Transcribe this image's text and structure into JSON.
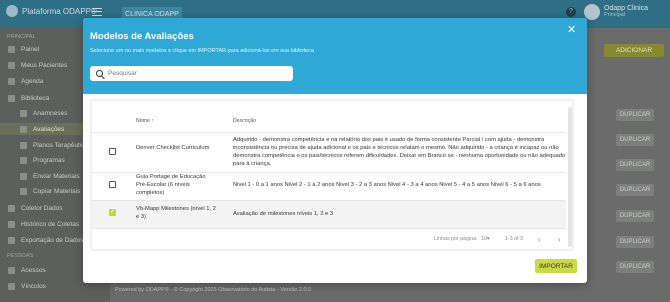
{
  "app": {
    "brand": "Plataforma ODAPP®",
    "clinic_button": "CLINICA ODAPP",
    "user_name": "Odapp Clinica",
    "user_role": "Principal"
  },
  "sidebar": {
    "section_main": "Principal",
    "items": [
      "Painel",
      "Meus Pacientes",
      "Agenda",
      "Biblioteca"
    ],
    "sub_items": [
      "Anamneses",
      "Avaliações",
      "Planos Terapêuticos",
      "Programas",
      "Enviar Materiais",
      "Copiar Materiais"
    ],
    "more_items": [
      "Coletor Dados",
      "Histórico de Coletas",
      "Exportação de Dados"
    ],
    "section_people": "Pessoas",
    "people_items": [
      "Acessos",
      "Vínculos"
    ]
  },
  "main": {
    "add_button": "ADICIONAR",
    "duplicate_label": "DUPLICAR",
    "footer": "Powered by ODAPP® - © Copyright 2025 Observatório do Autista - Versão 2.0.0"
  },
  "modal": {
    "title": "Modelos de Avaliações",
    "subtitle": "Selecione um ou mais modelos e clique em IMPORTAR para adicioná-los em sua biblioteca",
    "search_placeholder": "Pesquisar",
    "col_name": "Nome",
    "col_desc": "Descrição",
    "rows": [
      {
        "name": "Denver Checklist Curriculum",
        "desc": "Adquirido - demonstra competência e na relatório dos pais é usado de forma consistente Parcial / com ajuda - demonstra inconsistência ou precisa de ajuda adicional e os pais e técnicos relatam o mesmo. Não adquirido - a criança é incapaz ou não demonstra competência e os pais/técnicos referem dificuldades. Deixar em Branco se - nenhuma oportunidade ou não adequado para à criança."
      },
      {
        "name": "Guia Portage de Educação Pré-Escolar (6 níveis completos)",
        "desc": "Nivel 1 - 0 a 1 anos Nivel 2 - 1 a 2 anos Nivel 3 - 2 a 3 anos Nivel 4 - 3 a 4 anos Nivel 5 - 4 a 5 anos Nivel 6 - 5 a 6 anos"
      },
      {
        "name": "Vb-Mapp Milestones (nível 1, 2 e 3)",
        "desc": "Avaliação de milestones níveis 1, 2 e 3"
      }
    ],
    "rows_per_page_label": "Linhas por página:",
    "rows_per_page": "10",
    "range": "1-3 of 3",
    "import_button": "IMPORTAR"
  },
  "colors": {
    "header": "#2fa8d6",
    "accent": "#c8d94a"
  }
}
